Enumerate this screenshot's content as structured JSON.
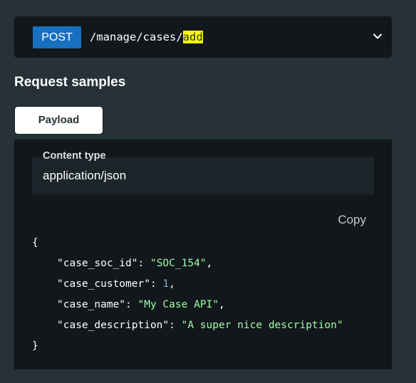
{
  "endpoint": {
    "method": "POST",
    "path_prefix": "/manage/cases/",
    "path_highlight": "add",
    "expand_icon": "chevron-down-icon",
    "method_color": "#186fc0",
    "highlight_color": "#ffff00"
  },
  "section": {
    "title": "Request samples"
  },
  "tabs": [
    {
      "label": "Payload",
      "active": true
    }
  ],
  "content_type": {
    "label": "Content type",
    "value": "application/json"
  },
  "copy_label": "Copy",
  "code": {
    "open_brace": "{",
    "close_brace": "}",
    "lines": [
      {
        "key": "\"case_soc_id\"",
        "value": "\"SOC_154\"",
        "value_type": "string",
        "trailing": ","
      },
      {
        "key": "\"case_customer\"",
        "value": "1",
        "value_type": "number",
        "trailing": ","
      },
      {
        "key": "\"case_name\"",
        "value": "\"My Case API\"",
        "value_type": "string",
        "trailing": ","
      },
      {
        "key": "\"case_description\"",
        "value": "\"A super nice description\"",
        "value_type": "string",
        "trailing": ""
      }
    ],
    "colors": {
      "string": "#a0fbaa",
      "number": "#7db1d6",
      "key": "#ffffff"
    }
  }
}
